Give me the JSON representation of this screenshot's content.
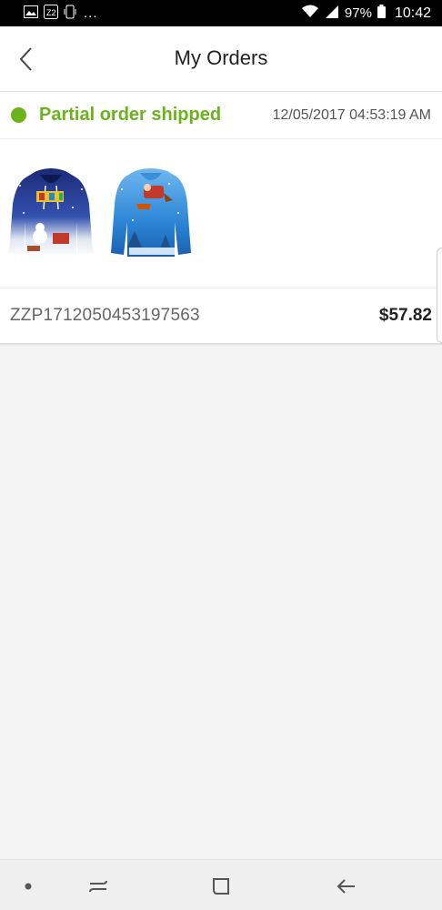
{
  "status_bar": {
    "overflow": "...",
    "battery": "97%",
    "time": "10:42"
  },
  "header": {
    "title": "My Orders",
    "back_icon": "chevron-left-icon"
  },
  "order": {
    "status": "Partial order shipped",
    "status_color": "#6bb31b",
    "date": "12/05/2017 04:53:19 AM",
    "number": "ZZP1712050453197563",
    "total": "$57.82",
    "items": [
      {
        "name": "christmas-hoodie-dark-blue"
      },
      {
        "name": "christmas-hoodie-light-blue"
      }
    ]
  },
  "nav": {
    "icons": [
      "dot-icon",
      "recent-apps-icon",
      "home-icon",
      "back-arrow-icon"
    ]
  }
}
